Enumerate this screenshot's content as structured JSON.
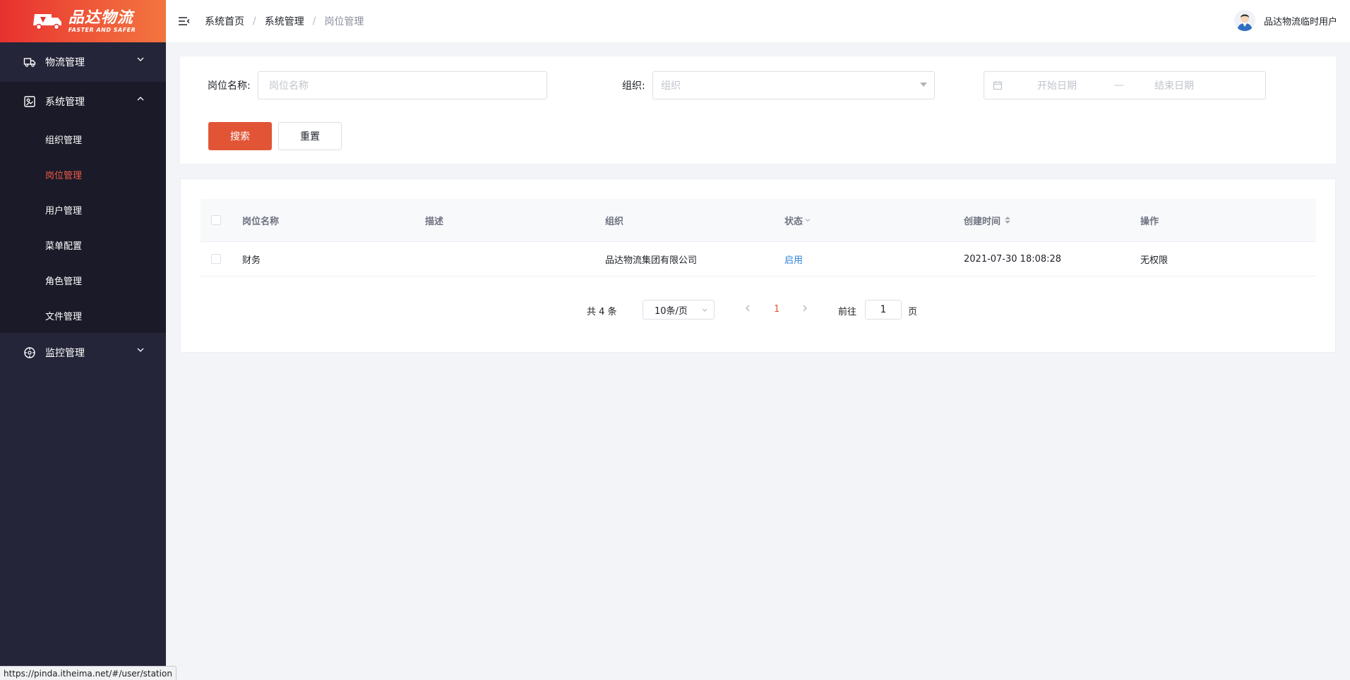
{
  "brand": {
    "name_cn": "品达物流",
    "name_en": "FASTER AND SAFER",
    "accent": "#e15536",
    "sidebar_bg": "#25253a",
    "active_menu_color": "#ef5a48"
  },
  "sidebar": {
    "groups": [
      {
        "label": "物流管理",
        "icon": "truck-icon",
        "expanded": false
      },
      {
        "label": "系统管理",
        "icon": "system-icon",
        "expanded": true,
        "items": [
          {
            "label": "组织管理",
            "active": false
          },
          {
            "label": "岗位管理",
            "active": true
          },
          {
            "label": "用户管理",
            "active": false
          },
          {
            "label": "菜单配置",
            "active": false
          },
          {
            "label": "角色管理",
            "active": false
          },
          {
            "label": "文件管理",
            "active": false
          }
        ]
      },
      {
        "label": "监控管理",
        "icon": "monitor-icon",
        "expanded": false
      }
    ]
  },
  "header": {
    "breadcrumb": [
      "系统首页",
      "系统管理",
      "岗位管理"
    ],
    "user_name": "品达物流临时用户"
  },
  "search": {
    "station_label": "岗位名称:",
    "station_placeholder": "岗位名称",
    "org_label": "组织:",
    "org_placeholder": "组织",
    "start_date_placeholder": "开始日期",
    "date_separator": "—",
    "end_date_placeholder": "结束日期",
    "search_button": "搜索",
    "reset_button": "重置"
  },
  "table": {
    "columns": [
      "岗位名称",
      "描述",
      "组织",
      "状态",
      "创建时间",
      "操作"
    ],
    "rows": [
      {
        "name": "财务",
        "desc": "",
        "org": "品达物流集团有限公司",
        "status": "启用",
        "created": "2021-07-30 18:08:28",
        "action": "无权限"
      }
    ]
  },
  "pagination": {
    "total_text": "共 4 条",
    "page_size": "10条/页",
    "current_page": "1",
    "goto_label": "前往",
    "goto_value": "1",
    "page_suffix": "页"
  },
  "statusbar": {
    "url": "https://pinda.itheima.net/#/user/station"
  }
}
